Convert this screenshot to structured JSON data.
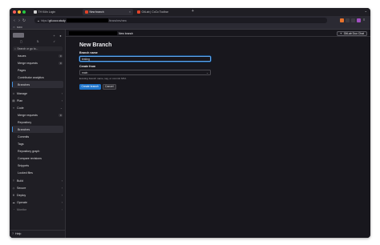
{
  "browser": {
    "tabs": [
      {
        "label": "TH Köln Login",
        "favicon_color": "#d0d0d0"
      },
      {
        "label": "New branch",
        "favicon_color": "#e24329",
        "active": true
      },
      {
        "label": "GitLab | CoCo Toolbar",
        "favicon_color": "#e24329"
      }
    ],
    "url": {
      "prefix": "https://",
      "host": "git.coco.study",
      "path_suffix": "/branches/new"
    },
    "bookmarks": [
      {
        "label": "soco"
      }
    ]
  },
  "sidebar": {
    "search_label": "Search or go to...",
    "items": [
      {
        "label": "Issues",
        "badge": "0"
      },
      {
        "label": "Merge requests",
        "badge": "0"
      },
      {
        "label": "Pages"
      },
      {
        "label": "Contributor analytics"
      },
      {
        "label": "Branches",
        "active": true
      }
    ],
    "sections": [
      {
        "label": "Manage",
        "icon": "users-icon"
      },
      {
        "label": "Plan",
        "icon": "plan-icon"
      },
      {
        "label": "Code",
        "icon": "code-icon"
      }
    ],
    "code_items": [
      {
        "label": "Merge requests",
        "badge": "0"
      },
      {
        "label": "Repository"
      },
      {
        "label": "Branches",
        "active": true
      },
      {
        "label": "Commits"
      },
      {
        "label": "Tags"
      },
      {
        "label": "Repository graph"
      },
      {
        "label": "Compare revisions"
      },
      {
        "label": "Snippets"
      },
      {
        "label": "Locked files"
      }
    ],
    "lower_sections": [
      {
        "label": "Build",
        "icon": "rocket-icon"
      },
      {
        "label": "Secure",
        "icon": "shield-icon"
      },
      {
        "label": "Deploy",
        "icon": "deploy-icon"
      },
      {
        "label": "Operate",
        "icon": "cloud-icon"
      },
      {
        "label": "Monitor",
        "icon": "monitor-icon"
      }
    ],
    "help_label": "Help"
  },
  "topbar": {
    "crumb_current": "New branch",
    "duo_label": "GitLab Duo Chat"
  },
  "form": {
    "title": "New Branch",
    "branch_name_label": "Branch name",
    "branch_name_value": "testing",
    "create_from_label": "Create from",
    "create_from_value": "main",
    "create_from_help": "Existing branch name, tag, or commit SHA",
    "submit_label": "Create branch",
    "cancel_label": "Cancel"
  },
  "colors": {
    "accent": "#1f75cb",
    "focus": "#63a6e9",
    "bg": "#18171d",
    "sidebar_bg": "#1f1e24"
  }
}
